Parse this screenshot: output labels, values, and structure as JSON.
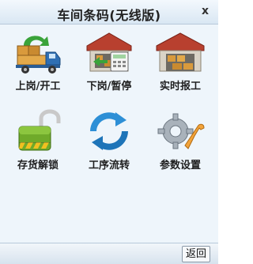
{
  "window": {
    "title": "车间条码(无线版)",
    "close_label": "x"
  },
  "menu": {
    "items": [
      {
        "label": "上岗/开工",
        "icon": "delivery-truck-icon"
      },
      {
        "label": "下岗/暂停",
        "icon": "warehouse-calculator-icon"
      },
      {
        "label": "实时报工",
        "icon": "warehouse-icon"
      },
      {
        "label": "存货解锁",
        "icon": "unlock-padlock-icon"
      },
      {
        "label": "工序流转",
        "icon": "refresh-arrows-icon"
      },
      {
        "label": "参数设置",
        "icon": "settings-gear-icon"
      }
    ]
  },
  "footer": {
    "back_label": "返回"
  }
}
